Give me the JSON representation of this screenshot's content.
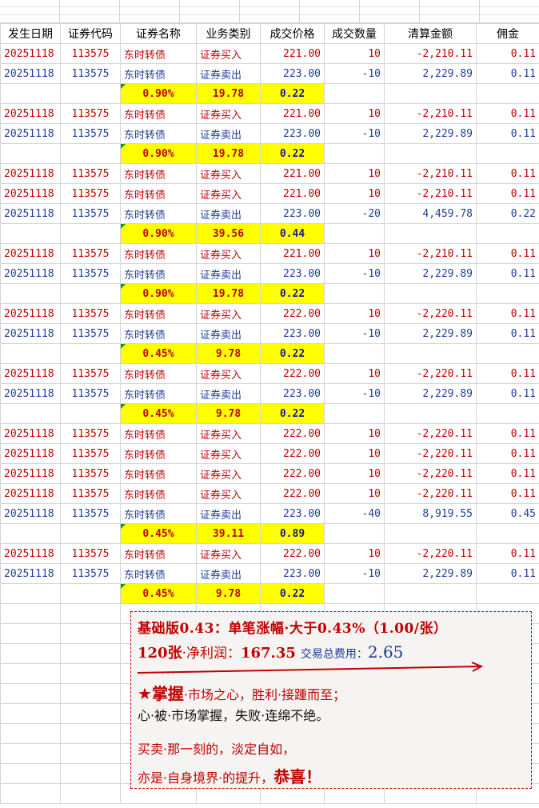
{
  "headers": [
    "发生日期",
    "证券代码",
    "证券名称",
    "业务类别",
    "成交价格",
    "成交数量",
    "清算金额",
    "佣金"
  ],
  "trades": [
    {
      "kind": "buy",
      "date": "20251118",
      "code": "113575",
      "name": "东时转债",
      "type": "证券买入",
      "price": "221.00",
      "qty": "10",
      "amount": "-2,210.11",
      "fee": "0.11"
    },
    {
      "kind": "sell",
      "date": "20251118",
      "code": "113575",
      "name": "东时转债",
      "type": "证券卖出",
      "price": "223.00",
      "qty": "-10",
      "amount": "2,229.89",
      "fee": "0.11"
    },
    {
      "kind": "sum",
      "pct": "0.90%",
      "profit": "19.78",
      "cost": "0.22"
    },
    {
      "kind": "buy",
      "date": "20251118",
      "code": "113575",
      "name": "东时转债",
      "type": "证券买入",
      "price": "221.00",
      "qty": "10",
      "amount": "-2,210.11",
      "fee": "0.11"
    },
    {
      "kind": "sell",
      "date": "20251118",
      "code": "113575",
      "name": "东时转债",
      "type": "证券卖出",
      "price": "223.00",
      "qty": "-10",
      "amount": "2,229.89",
      "fee": "0.11"
    },
    {
      "kind": "sum",
      "pct": "0.90%",
      "profit": "19.78",
      "cost": "0.22"
    },
    {
      "kind": "buy",
      "date": "20251118",
      "code": "113575",
      "name": "东时转债",
      "type": "证券买入",
      "price": "221.00",
      "qty": "10",
      "amount": "-2,210.11",
      "fee": "0.11"
    },
    {
      "kind": "buy",
      "date": "20251118",
      "code": "113575",
      "name": "东时转债",
      "type": "证券买入",
      "price": "221.00",
      "qty": "10",
      "amount": "-2,210.11",
      "fee": "0.11"
    },
    {
      "kind": "sell",
      "date": "20251118",
      "code": "113575",
      "name": "东时转债",
      "type": "证券卖出",
      "price": "223.00",
      "qty": "-20",
      "amount": "4,459.78",
      "fee": "0.22"
    },
    {
      "kind": "sum",
      "pct": "0.90%",
      "profit": "39.56",
      "cost": "0.44"
    },
    {
      "kind": "buy",
      "date": "20251118",
      "code": "113575",
      "name": "东时转债",
      "type": "证券买入",
      "price": "221.00",
      "qty": "10",
      "amount": "-2,210.11",
      "fee": "0.11"
    },
    {
      "kind": "sell",
      "date": "20251118",
      "code": "113575",
      "name": "东时转债",
      "type": "证券卖出",
      "price": "223.00",
      "qty": "-10",
      "amount": "2,229.89",
      "fee": "0.11"
    },
    {
      "kind": "sum",
      "pct": "0.90%",
      "profit": "19.78",
      "cost": "0.22"
    },
    {
      "kind": "buy",
      "date": "20251118",
      "code": "113575",
      "name": "东时转债",
      "type": "证券买入",
      "price": "222.00",
      "qty": "10",
      "amount": "-2,220.11",
      "fee": "0.11"
    },
    {
      "kind": "sell",
      "date": "20251118",
      "code": "113575",
      "name": "东时转债",
      "type": "证券卖出",
      "price": "223.00",
      "qty": "-10",
      "amount": "2,229.89",
      "fee": "0.11"
    },
    {
      "kind": "sum",
      "pct": "0.45%",
      "profit": "9.78",
      "cost": "0.22"
    },
    {
      "kind": "buy",
      "date": "20251118",
      "code": "113575",
      "name": "东时转债",
      "type": "证券买入",
      "price": "222.00",
      "qty": "10",
      "amount": "-2,220.11",
      "fee": "0.11"
    },
    {
      "kind": "sell",
      "date": "20251118",
      "code": "113575",
      "name": "东时转债",
      "type": "证券卖出",
      "price": "223.00",
      "qty": "-10",
      "amount": "2,229.89",
      "fee": "0.11"
    },
    {
      "kind": "sum",
      "pct": "0.45%",
      "profit": "9.78",
      "cost": "0.22"
    },
    {
      "kind": "buy",
      "date": "20251118",
      "code": "113575",
      "name": "东时转债",
      "type": "证券买入",
      "price": "222.00",
      "qty": "10",
      "amount": "-2,220.11",
      "fee": "0.11"
    },
    {
      "kind": "buy",
      "date": "20251118",
      "code": "113575",
      "name": "东时转债",
      "type": "证券买入",
      "price": "222.00",
      "qty": "10",
      "amount": "-2,220.11",
      "fee": "0.11"
    },
    {
      "kind": "buy",
      "date": "20251118",
      "code": "113575",
      "name": "东时转债",
      "type": "证券买入",
      "price": "222.00",
      "qty": "10",
      "amount": "-2,220.11",
      "fee": "0.11"
    },
    {
      "kind": "buy",
      "date": "20251118",
      "code": "113575",
      "name": "东时转债",
      "type": "证券买入",
      "price": "222.00",
      "qty": "10",
      "amount": "-2,220.11",
      "fee": "0.11"
    },
    {
      "kind": "sell",
      "date": "20251118",
      "code": "113575",
      "name": "东时转债",
      "type": "证券卖出",
      "price": "223.00",
      "qty": "-40",
      "amount": "8,919.55",
      "fee": "0.45"
    },
    {
      "kind": "sum",
      "pct": "0.45%",
      "profit": "39.11",
      "cost": "0.89"
    },
    {
      "kind": "buy",
      "date": "20251118",
      "code": "113575",
      "name": "东时转债",
      "type": "证券买入",
      "price": "222.00",
      "qty": "10",
      "amount": "-2,220.11",
      "fee": "0.11"
    },
    {
      "kind": "sell",
      "date": "20251118",
      "code": "113575",
      "name": "东时转债",
      "type": "证券卖出",
      "price": "223.00",
      "qty": "-10",
      "amount": "2,229.89",
      "fee": "0.11"
    },
    {
      "kind": "sum",
      "pct": "0.45%",
      "profit": "9.78",
      "cost": "0.22"
    }
  ],
  "note": {
    "line1": "基础版0.43：单笔涨幅·大于0.43%（1.00/张）",
    "qty_label": "120张",
    "profit_label": "·净利润：",
    "profit_value": "167.35",
    "fee_label": "交易总费用：",
    "fee_value": "2.65",
    "line3_star": "★",
    "line3_big": "掌握",
    "line3_rest": "·市场之心，胜利·接踵而至；",
    "line4": "心·被·市场掌握，失败·连绵不绝。",
    "line5": "买卖·那一刻的，淡定自如，",
    "line6_pre": "亦是·自身境界·的提升，",
    "line6_big": "恭喜！"
  },
  "colors": {
    "buy": "#c00000",
    "sell": "#1f3d99",
    "highlight": "#ffff00"
  }
}
